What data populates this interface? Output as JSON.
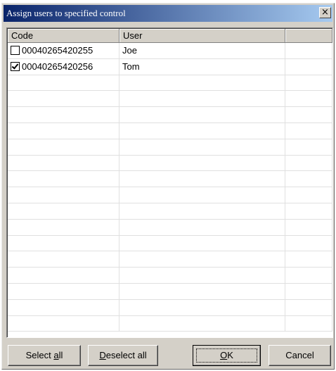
{
  "window": {
    "title": "Assign users to specified control",
    "close_label": "×"
  },
  "table": {
    "columns": [
      "Code",
      "User",
      ""
    ],
    "rows": [
      {
        "checked": false,
        "code": "00040265420255",
        "user": "Joe"
      },
      {
        "checked": true,
        "code": "00040265420256",
        "user": "Tom"
      }
    ]
  },
  "buttons": {
    "select_all": "Select all",
    "deselect_all": "Deselect all",
    "ok": "OK",
    "cancel": "Cancel"
  }
}
